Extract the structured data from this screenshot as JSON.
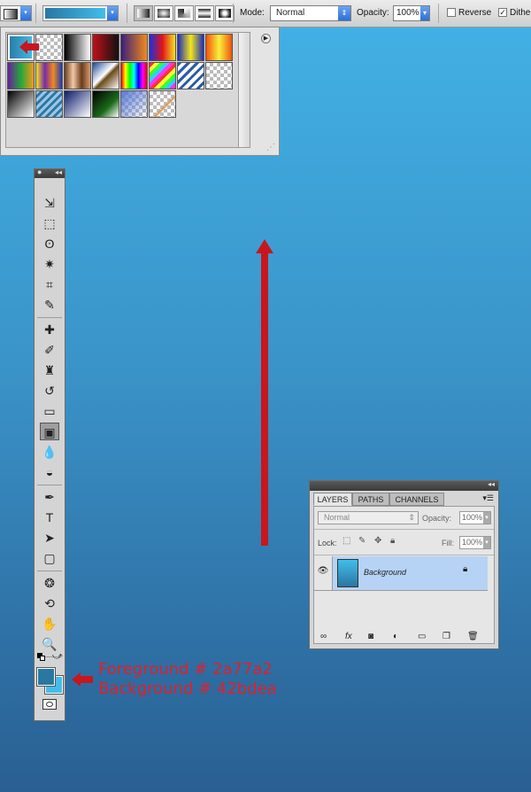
{
  "options_bar": {
    "mode_label": "Mode:",
    "mode_value": "Normal",
    "opacity_label": "Opacity:",
    "opacity_value": "100%",
    "reverse_label": "Reverse",
    "dither_label": "Dither",
    "reverse_checked": false,
    "dither_checked": true
  },
  "gradient_picker": {
    "menu_icon": "flyout-arrow-icon",
    "swatches": [
      {
        "name": "foreground-to-background",
        "css": "linear-gradient(90deg,#2a77a2,#42bdea)"
      },
      {
        "name": "foreground-to-transparent",
        "css": "repeating-conic-gradient(#bbb 0 25%,#fff 0 50%) 0 0/8px 8px"
      },
      {
        "name": "black-white",
        "css": "linear-gradient(90deg,#000,#fff)"
      },
      {
        "name": "red-black",
        "css": "linear-gradient(90deg,#c0101a,#111)"
      },
      {
        "name": "violet-orange",
        "css": "linear-gradient(90deg,#3b1f7c,#f08a1a)"
      },
      {
        "name": "blue-red-yellow",
        "css": "linear-gradient(90deg,#1e2fd8,#e0141a,#f6e21a)"
      },
      {
        "name": "blue-yellow-blue",
        "css": "linear-gradient(90deg,#1d2db8,#f3e71a,#1d2db8)"
      },
      {
        "name": "orange-yellow-orange",
        "css": "linear-gradient(90deg,#f2520f,#f8f23a,#f2520f)"
      },
      {
        "name": "violet-green-orange",
        "css": "linear-gradient(90deg,#6a1e9e,#22a83a,#f39a1a)"
      },
      {
        "name": "yellow-violet-orange-blue",
        "css": "linear-gradient(90deg,#f3e21a,#7a2aa8,#f08a1a,#1d3ab8)"
      },
      {
        "name": "copper",
        "css": "linear-gradient(90deg,#6a3a1c,#f2c8a6,#6a3a1c,#d89a70)"
      },
      {
        "name": "chrome",
        "css": "linear-gradient(135deg,#1a4a9a,#fff 45%,#6a4a1a 55%,#fff)"
      },
      {
        "name": "spectrum",
        "css": "linear-gradient(90deg,#f00,#ff0,#0f0,#0ff,#00f,#f0f,#f00)"
      },
      {
        "name": "transparent-rainbow",
        "css": "repeating-linear-gradient(135deg,#f33 0 4px,#ff3 4px 8px,#3f3 8px 12px,#3cf 12px 16px,#f3f 16px 20px)"
      },
      {
        "name": "transparent-stripes",
        "css": "repeating-linear-gradient(135deg,#2a5aa8 0 3px,#fff 3px 7px)"
      },
      {
        "name": "transparent-checker",
        "css": "repeating-conic-gradient(#bbb 0 25%,#fff 0 50%) 0 0/8px 8px"
      },
      {
        "name": "black-white-diagonal",
        "css": "linear-gradient(135deg,#000,#fff)"
      },
      {
        "name": "blue-stripes",
        "css": "repeating-linear-gradient(135deg,#9cc4e6 0 3px,#2a77a2 3px 6px)"
      },
      {
        "name": "navy-white",
        "css": "linear-gradient(135deg,#0a1a6a,#fff)"
      },
      {
        "name": "green-black",
        "css": "linear-gradient(135deg,#000,#1a6a1a 60%,#fff)"
      },
      {
        "name": "blue-white-checker",
        "css": "linear-gradient(135deg,#5a7ad8,transparent),repeating-conic-gradient(#bbb 0 25%,#fff 0 50%) 0 0/8px 8px"
      },
      {
        "name": "orange-stripe-checker",
        "css": "linear-gradient(135deg,transparent 55%,#e08a3a 60%,transparent 65%),repeating-conic-gradient(#bbb 0 25%,#fff 0 50%) 0 0/8px 8px"
      }
    ]
  },
  "toolbox": {
    "tools": [
      {
        "name": "move-tool",
        "glyph": "⇲"
      },
      {
        "name": "marquee-tool",
        "glyph": "⬚"
      },
      {
        "name": "lasso-tool",
        "glyph": "ʘ"
      },
      {
        "name": "magic-wand-tool",
        "glyph": "✷"
      },
      {
        "name": "crop-tool",
        "glyph": "⌗"
      },
      {
        "name": "eyedropper-tool",
        "glyph": "✎"
      },
      {
        "name": "healing-brush-tool",
        "glyph": "✚"
      },
      {
        "name": "brush-tool",
        "glyph": "✐"
      },
      {
        "name": "clone-stamp-tool",
        "glyph": "♜"
      },
      {
        "name": "history-brush-tool",
        "glyph": "↺"
      },
      {
        "name": "eraser-tool",
        "glyph": "▭"
      },
      {
        "name": "gradient-tool",
        "glyph": "▣"
      },
      {
        "name": "blur-tool",
        "glyph": "💧"
      },
      {
        "name": "dodge-tool",
        "glyph": "◒"
      },
      {
        "name": "pen-tool",
        "glyph": "✒"
      },
      {
        "name": "type-tool",
        "glyph": "T"
      },
      {
        "name": "path-selection-tool",
        "glyph": "➤"
      },
      {
        "name": "shape-tool",
        "glyph": "▢"
      },
      {
        "name": "3d-rotate-tool",
        "glyph": "❂"
      },
      {
        "name": "3d-orbit-tool",
        "glyph": "⟲"
      },
      {
        "name": "hand-tool",
        "glyph": "✋"
      },
      {
        "name": "zoom-tool",
        "glyph": "🔍"
      }
    ],
    "foreground_color": "#2a77a2",
    "background_color": "#42bdea"
  },
  "annotation": {
    "foreground_text": "Foreground # 2a77a2",
    "background_text": "Background # 42bdea",
    "arrow_color": "#c8161e"
  },
  "layers_panel": {
    "tabs": [
      "LAYERS",
      "PATHS",
      "CHANNELS"
    ],
    "blend_mode": "Normal",
    "opacity_label": "Opacity:",
    "opacity_value": "100%",
    "lock_label": "Lock:",
    "fill_label": "Fill:",
    "fill_value": "100%",
    "layers": [
      {
        "name": "Background",
        "visible": true,
        "locked": true
      }
    ],
    "footer_icons": [
      "link-icon",
      "fx-icon",
      "mask-icon",
      "adjustment-icon",
      "folder-icon",
      "new-layer-icon",
      "trash-icon"
    ]
  }
}
